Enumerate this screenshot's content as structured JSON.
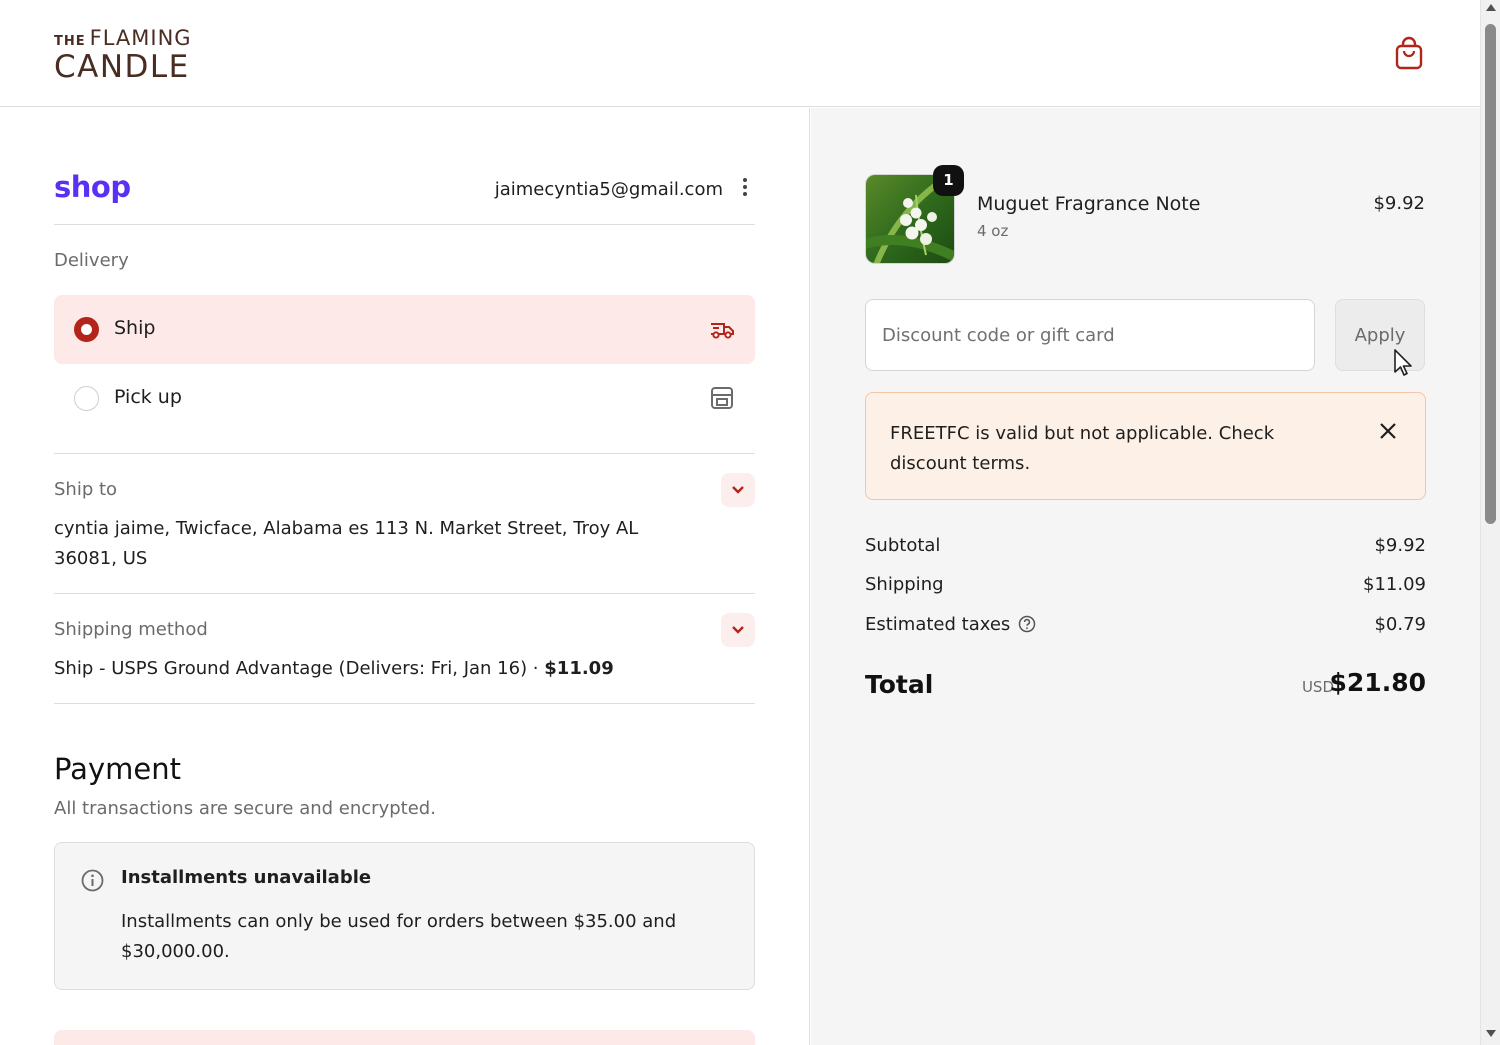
{
  "header": {
    "logo_small": "THE",
    "logo_line1": "FLAMING",
    "logo_line2": "CANDLE",
    "cart_icon": "shopping-bag-icon",
    "brand_color": "#b3251b"
  },
  "account": {
    "shop_logo": "shop",
    "email": "jaimecyntia5@gmail.com",
    "menu_icon": "kebab-menu-icon"
  },
  "delivery": {
    "label": "Delivery",
    "options": [
      {
        "label": "Ship",
        "selected": true,
        "icon": "truck-icon"
      },
      {
        "label": "Pick up",
        "selected": false,
        "icon": "store-icon"
      }
    ]
  },
  "ship_to": {
    "label": "Ship to",
    "address": "cyntia jaime, Twicface, Alabama es 113 N. Market Street, Troy AL 36081, US"
  },
  "shipping_method": {
    "label": "Shipping method",
    "value": "Ship - USPS Ground Advantage (Delivers: Fri, Jan 16) · ",
    "price": "$11.09"
  },
  "payment": {
    "title": "Payment",
    "subtitle": "All transactions are secure and encrypted.",
    "notice_title": "Installments unavailable",
    "notice_body": "Installments can only be used for orders between $35.00 and $30,000.00."
  },
  "order": {
    "product": {
      "name": "Muguet Fragrance Note",
      "variant": "4 oz",
      "price": "$9.92",
      "quantity": "1"
    },
    "discount": {
      "placeholder": "Discount code or gift card",
      "apply_label": "Apply",
      "alert": "FREETFC is valid but not applicable. Check discount terms."
    },
    "summary": {
      "subtotal_label": "Subtotal",
      "subtotal": "$9.92",
      "shipping_label": "Shipping",
      "shipping": "$11.09",
      "taxes_label": "Estimated taxes",
      "taxes": "$0.79",
      "total_label": "Total",
      "currency": "USD",
      "total": "$21.80"
    }
  }
}
